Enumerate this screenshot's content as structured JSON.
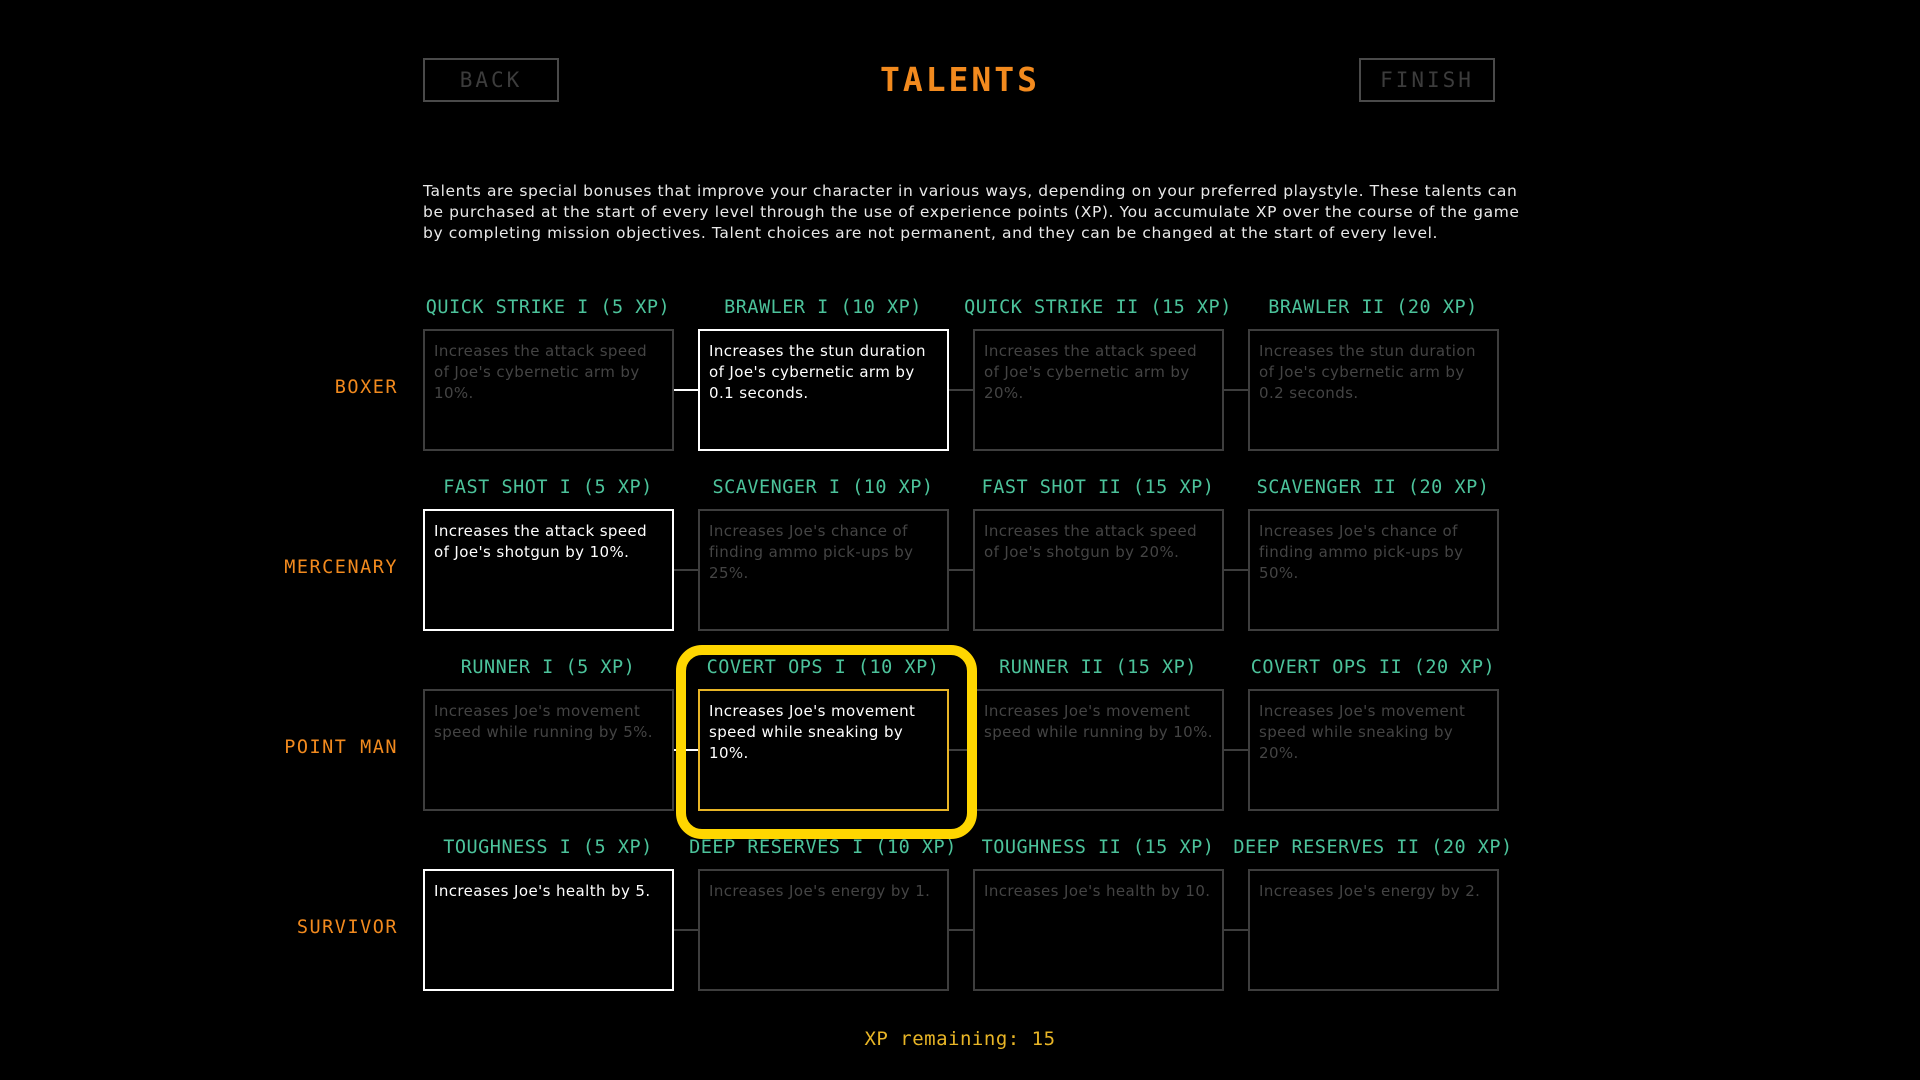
{
  "header": {
    "back_label": "BACK",
    "title": "TALENTS",
    "finish_label": "FINISH"
  },
  "description": "Talents are special bonuses that improve your character in various ways, depending on your preferred playstyle. These talents can be purchased at the start of every level through the use of experience points (XP). You accumulate XP over the course of the game by completing mission objectives. Talent choices are not permanent, and they can be changed at the start of every level.",
  "rows": [
    {
      "label": "BOXER",
      "talents": [
        {
          "name": "QUICK STRIKE I (5 XP)",
          "desc": "Increases the attack speed of Joe's cybernetic arm by 10%.",
          "state": "purchased"
        },
        {
          "name": "BRAWLER I (10 XP)",
          "desc": "Increases the stun duration of Joe's cybernetic arm by 0.1 seconds.",
          "state": "available"
        },
        {
          "name": "QUICK STRIKE II (15 XP)",
          "desc": "Increases the attack speed of Joe's cybernetic arm by 20%.",
          "state": "locked"
        },
        {
          "name": "BRAWLER II (20 XP)",
          "desc": "Increases the stun duration of Joe's cybernetic arm by 0.2 seconds.",
          "state": "locked"
        }
      ]
    },
    {
      "label": "MERCENARY",
      "talents": [
        {
          "name": "FAST SHOT I (5 XP)",
          "desc": "Increases the attack speed of Joe's shotgun by 10%.",
          "state": "available"
        },
        {
          "name": "SCAVENGER I (10 XP)",
          "desc": "Increases Joe's chance of finding ammo pick-ups by 25%.",
          "state": "locked"
        },
        {
          "name": "FAST SHOT II (15 XP)",
          "desc": "Increases the attack speed of Joe's shotgun by 20%.",
          "state": "locked"
        },
        {
          "name": "SCAVENGER II (20 XP)",
          "desc": "Increases Joe's chance of finding ammo pick-ups by 50%.",
          "state": "locked"
        }
      ]
    },
    {
      "label": "POINT MAN",
      "talents": [
        {
          "name": "RUNNER I (5 XP)",
          "desc": "Increases Joe's movement speed while running by 5%.",
          "state": "purchased"
        },
        {
          "name": "COVERT OPS I (10 XP)",
          "desc": "Increases Joe's movement speed while sneaking by 10%.",
          "state": "selected"
        },
        {
          "name": "RUNNER II (15 XP)",
          "desc": "Increases Joe's movement speed while running by 10%.",
          "state": "locked"
        },
        {
          "name": "COVERT OPS II (20 XP)",
          "desc": "Increases Joe's movement speed while sneaking by 20%.",
          "state": "locked"
        }
      ]
    },
    {
      "label": "SURVIVOR",
      "talents": [
        {
          "name": "TOUGHNESS I (5 XP)",
          "desc": "Increases Joe's health by 5.",
          "state": "available"
        },
        {
          "name": "DEEP RESERVES I (10 XP)",
          "desc": "Increases Joe's energy by 1.",
          "state": "locked"
        },
        {
          "name": "TOUGHNESS II (15 XP)",
          "desc": "Increases Joe's health by 10.",
          "state": "locked"
        },
        {
          "name": "DEEP RESERVES II (20 XP)",
          "desc": "Increases Joe's energy by 2.",
          "state": "locked"
        }
      ]
    }
  ],
  "footer": {
    "xp_remaining": "XP remaining: 15"
  },
  "colors": {
    "accent_orange": "#f28a1e",
    "talent_name_green": "#4cc39b",
    "purchased_gold": "#e8b526",
    "selection_highlight": "#ffd600"
  }
}
